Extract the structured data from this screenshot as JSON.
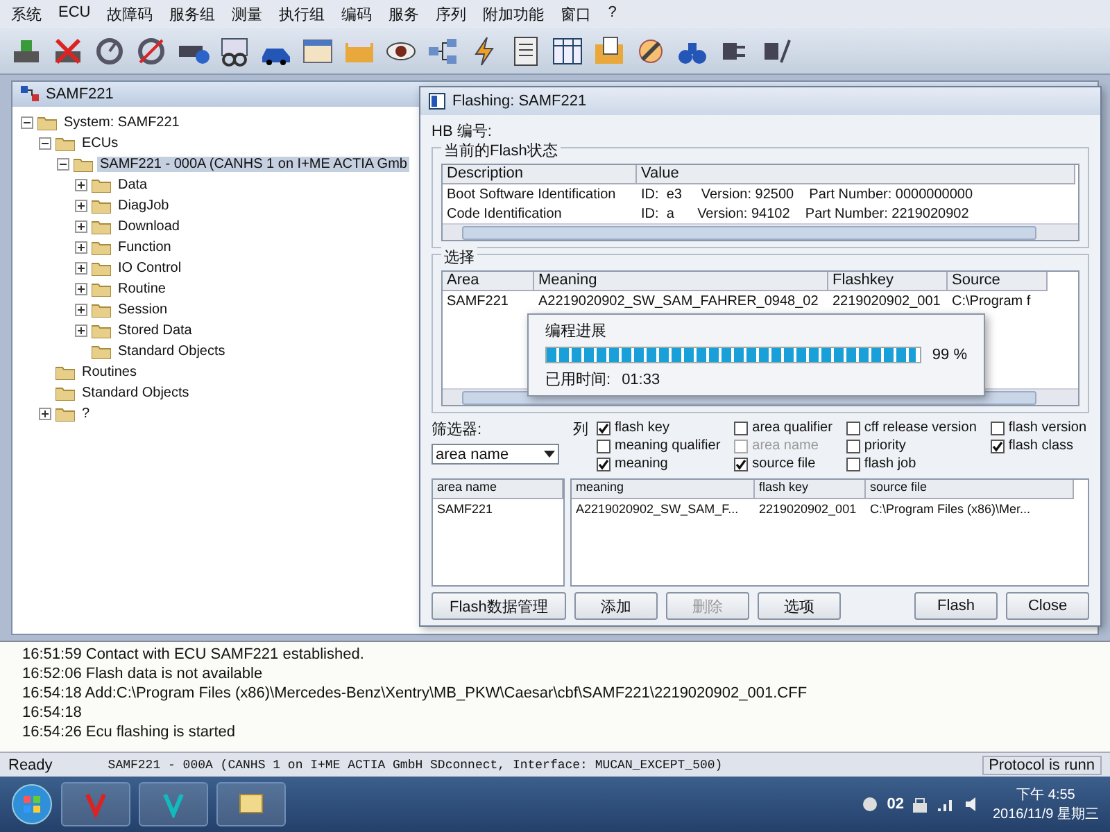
{
  "menu": [
    "系统",
    "ECU",
    "故障码",
    "服务组",
    "测量",
    "执行组",
    "编码",
    "服务",
    "序列",
    "附加功能",
    "窗口",
    "?"
  ],
  "tree_window": {
    "title": "SAMF221",
    "tree": [
      {
        "label": "System: SAMF221",
        "expanded": true,
        "selected": false,
        "children": [
          {
            "label": "ECUs",
            "expanded": true,
            "selected": false,
            "children": [
              {
                "label": "SAMF221 - 000A (CANHS 1 on I+ME ACTIA Gmb",
                "expanded": true,
                "selected": true,
                "children": [
                  {
                    "label": "Data",
                    "expanded": false,
                    "selected": false
                  },
                  {
                    "label": "DiagJob",
                    "expanded": false,
                    "selected": false
                  },
                  {
                    "label": "Download",
                    "expanded": false,
                    "selected": false
                  },
                  {
                    "label": "Function",
                    "expanded": false,
                    "selected": false
                  },
                  {
                    "label": "IO Control",
                    "expanded": false,
                    "selected": false
                  },
                  {
                    "label": "Routine",
                    "expanded": false,
                    "selected": false
                  },
                  {
                    "label": "Session",
                    "expanded": false,
                    "selected": false
                  },
                  {
                    "label": "Stored Data",
                    "expanded": false,
                    "selected": false
                  },
                  {
                    "label": "Standard Objects",
                    "selected": false
                  }
                ]
              }
            ]
          },
          {
            "label": "Routines",
            "selected": false
          },
          {
            "label": "Standard Objects",
            "selected": false
          },
          {
            "label": "?",
            "expanded": false,
            "selected": false
          }
        ]
      }
    ]
  },
  "dialog": {
    "title": "Flashing: SAMF221",
    "hb_label": "HB 编号:",
    "status_group": {
      "title": "当前的Flash状态",
      "columns": [
        "Description",
        "Value"
      ],
      "rows": [
        [
          "Boot Software Identification",
          "ID:  e3     Version: 92500    Part Number: 0000000000"
        ],
        [
          "Code Identification",
          "ID:  a      Version: 94102    Part Number: 2219020902"
        ]
      ]
    },
    "selection_group": {
      "title": "选择",
      "columns": [
        "Area",
        "Meaning",
        "Flashkey",
        "Source"
      ],
      "rows": [
        [
          "SAMF221",
          "A2219020902_SW_SAM_FAHRER_0948_02",
          "2219020902_001",
          "C:\\Program f"
        ]
      ]
    },
    "filter": {
      "label": "筛选器:",
      "value": "area name"
    },
    "columns_label": "列",
    "checkboxes": [
      {
        "label": "flash key",
        "checked": true,
        "disabled": false
      },
      {
        "label": "meaning qualifier",
        "checked": false,
        "disabled": false
      },
      {
        "label": "meaning",
        "checked": true,
        "disabled": false
      },
      {
        "label": "area qualifier",
        "checked": false,
        "disabled": false
      },
      {
        "label": "area name",
        "checked": false,
        "disabled": true
      },
      {
        "label": "source file",
        "checked": true,
        "disabled": false
      },
      {
        "label": "cff release version",
        "checked": false,
        "disabled": false
      },
      {
        "label": "priority",
        "checked": false,
        "disabled": false
      },
      {
        "label": "flash job",
        "checked": false,
        "disabled": false
      },
      {
        "label": "flash version",
        "checked": false,
        "disabled": false
      },
      {
        "label": "flash class",
        "checked": true,
        "disabled": false
      }
    ],
    "area_list": {
      "header": "area name",
      "items": [
        "SAMF221"
      ]
    },
    "result_table": {
      "columns": [
        "meaning",
        "flash key",
        "source file"
      ],
      "rows": [
        [
          "A2219020902_SW_SAM_F...",
          "2219020902_001",
          "C:\\Program Files (x86)\\Mer..."
        ]
      ]
    },
    "buttons": [
      {
        "label": "Flash数据管理",
        "disabled": false
      },
      {
        "label": "添加",
        "disabled": false
      },
      {
        "label": "删除",
        "disabled": true
      },
      {
        "label": "选项",
        "disabled": false
      }
    ],
    "action_buttons": [
      {
        "label": "Flash",
        "disabled": false
      },
      {
        "label": "Close",
        "disabled": false
      }
    ]
  },
  "progress": {
    "title": "编程进展",
    "level": 0.99,
    "percent": "99 %",
    "elapsed_label": "已用时间:",
    "elapsed": "01:33"
  },
  "log": [
    "16:51:59 Contact with ECU SAMF221 established.",
    "16:52:06 Flash data is not available",
    "16:54:18 Add:C:\\Program Files (x86)\\Mercedes-Benz\\Xentry\\MB_PKW\\Caesar\\cbf\\SAMF221\\2219020902_001.CFF",
    "16:54:18",
    "16:54:26 Ecu flashing is started"
  ],
  "status_bar": {
    "left": "Ready",
    "center": "SAMF221 - 000A (CANHS 1 on I+ME ACTIA GmbH SDconnect, Interface: MUCAN_EXCEPT_500)",
    "right": "Protocol is runn"
  },
  "taskbar": {
    "tray_badge": "02",
    "time": "下午 4:55",
    "date": "2016/11/9 星期三"
  }
}
